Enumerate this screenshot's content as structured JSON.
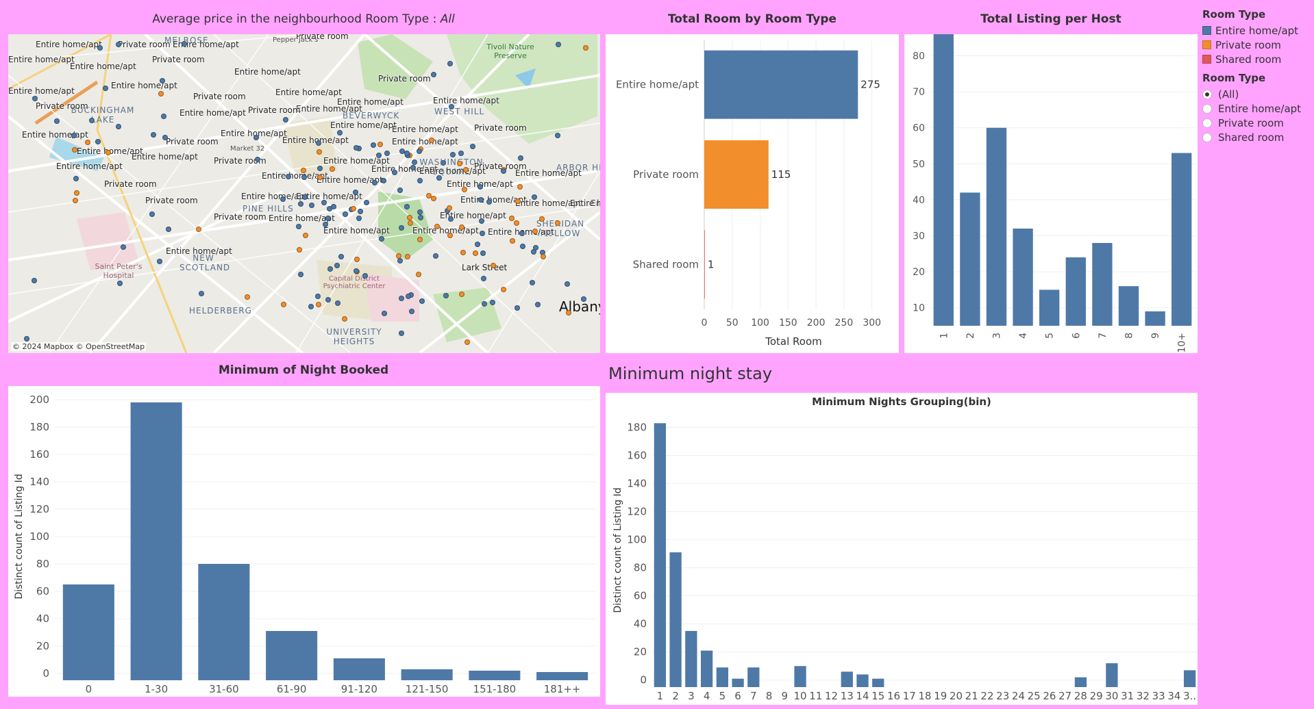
{
  "map": {
    "title_prefix": "Average price in the neighbourhood Room Type :",
    "title_value": "All",
    "attribution": "© 2024 Mapbox © OpenStreetMap",
    "places": [
      "MELROSE",
      "BUCKINGHAM LAKE",
      "BEVERWYCK",
      "WEST HILL",
      "WASHINGTON SQUARE",
      "ARBOR HILL",
      "PINE HILLS",
      "SHERIDAN HOLLOW",
      "NEW SCOTLAND",
      "HELDERBERG",
      "UNIVERSITY HEIGHTS",
      "Albany",
      "Tivoli Nature Preserve",
      "Saint Peter's Hospital",
      "Capital District Psychiatric Center",
      "Lark Street",
      "Market 32",
      "Pepper Jack's"
    ],
    "labels": [
      "Entire home/apt",
      "Private room",
      "Entire home/apt",
      "Private room",
      "Entire home/apt",
      "Entire home/apt",
      "Private room",
      "Entire home/apt",
      "Entire home/apt",
      "Private room",
      "Entire home/apt",
      "Entire home/apt",
      "Private room",
      "Entire home/apt",
      "Entire home/apt",
      "Private room",
      "Entire home/apt",
      "Entire home/apt",
      "Private room",
      "Entire home/apt",
      "Entire home/apt",
      "Private room",
      "Entire home/apt",
      "Entire home/apt",
      "Private room",
      "Entire home/apt",
      "Entire home/apt",
      "Entire home/apt",
      "Private room",
      "Entire home/apt",
      "Entire home/apt",
      "Private room",
      "Entire home/apt",
      "Entire home/apt",
      "Entire home/apt",
      "Private room",
      "Entire home/apt",
      "Entire home/apt",
      "Entire home/apt",
      "Entire home/apt",
      "Private room",
      "Entire home/apt",
      "Entire home/apt",
      "Entire home/apt",
      "Entire home/apt",
      "Entire home/apt",
      "Private room",
      "Entire home/apt",
      "Entire home/apt",
      "Entire home/apt",
      "Entire home/apt",
      "Entire home/apt",
      "Entire home/apt",
      "Entire home/apt"
    ]
  },
  "legend": {
    "color_header": "Room Type",
    "colors": [
      {
        "label": "Entire home/apt",
        "color": "#4e79a7"
      },
      {
        "label": "Private room",
        "color": "#f28e2b"
      },
      {
        "label": "Shared room",
        "color": "#e15759"
      }
    ],
    "filter_header": "Room Type",
    "filter_options": [
      {
        "label": "(All)",
        "selected": true
      },
      {
        "label": "Entire home/apt",
        "selected": false
      },
      {
        "label": "Private room",
        "selected": false
      },
      {
        "label": "Shared room",
        "selected": false
      }
    ]
  },
  "section_title": "Minimum night stay",
  "chart_data": [
    {
      "id": "room_type",
      "type": "bar",
      "orientation": "horizontal",
      "title": "Total Room by Room Type",
      "categories": [
        "Entire home/apt",
        "Private room",
        "Shared room"
      ],
      "values": [
        275,
        115,
        1
      ],
      "colors": [
        "#4e79a7",
        "#f28e2b",
        "#e15759"
      ],
      "xlabel": "Total Room",
      "xlim": [
        0,
        320
      ],
      "ticks": [
        0,
        50,
        100,
        150,
        200,
        250,
        300
      ]
    },
    {
      "id": "per_host",
      "type": "bar",
      "title": "Total Listing per Host",
      "categories": [
        "1",
        "2",
        "3",
        "4",
        "5",
        "6",
        "7",
        "8",
        "9",
        "10+"
      ],
      "values": [
        86,
        42,
        60,
        32,
        15,
        24,
        28,
        16,
        9,
        53
      ],
      "ylim": [
        5,
        86
      ],
      "ticks": [
        10,
        20,
        30,
        40,
        50,
        60,
        70,
        80
      ],
      "color": "#4e79a7"
    },
    {
      "id": "min_night_booked",
      "type": "bar",
      "title": "Minimum of Night Booked",
      "categories": [
        "0",
        "1-30",
        "31-60",
        "61-90",
        "91-120",
        "121-150",
        "151-180",
        "181++"
      ],
      "values": [
        65,
        198,
        80,
        31,
        11,
        3,
        2,
        1
      ],
      "ylabel": "Distinct count of Listing Id",
      "ylim": [
        -5,
        205
      ],
      "ticks": [
        0,
        20,
        40,
        60,
        80,
        100,
        120,
        140,
        160,
        180,
        200
      ],
      "color": "#4e79a7"
    },
    {
      "id": "min_nights_bin",
      "type": "bar",
      "title": "Minimum Nights Grouping(bin)",
      "categories": [
        "1",
        "2",
        "3",
        "4",
        "5",
        "6",
        "7",
        "8",
        "9",
        "10",
        "11",
        "12",
        "13",
        "14",
        "15",
        "16",
        "17",
        "18",
        "19",
        "20",
        "21",
        "22",
        "23",
        "24",
        "25",
        "26",
        "27",
        "28",
        "29",
        "30",
        "31",
        "32",
        "33",
        "34",
        "3.."
      ],
      "values": [
        183,
        91,
        35,
        21,
        9,
        1,
        9,
        0,
        0,
        10,
        0,
        0,
        6,
        4,
        1,
        0,
        0,
        0,
        0,
        0,
        0,
        0,
        0,
        0,
        0,
        0,
        0,
        2,
        0,
        12,
        0,
        0,
        0,
        0,
        7
      ],
      "ylabel": "Distinct count of Listing Id",
      "ylim": [
        -5,
        190
      ],
      "ticks": [
        0,
        20,
        40,
        60,
        80,
        100,
        120,
        140,
        160,
        180
      ],
      "color": "#4e79a7"
    }
  ]
}
